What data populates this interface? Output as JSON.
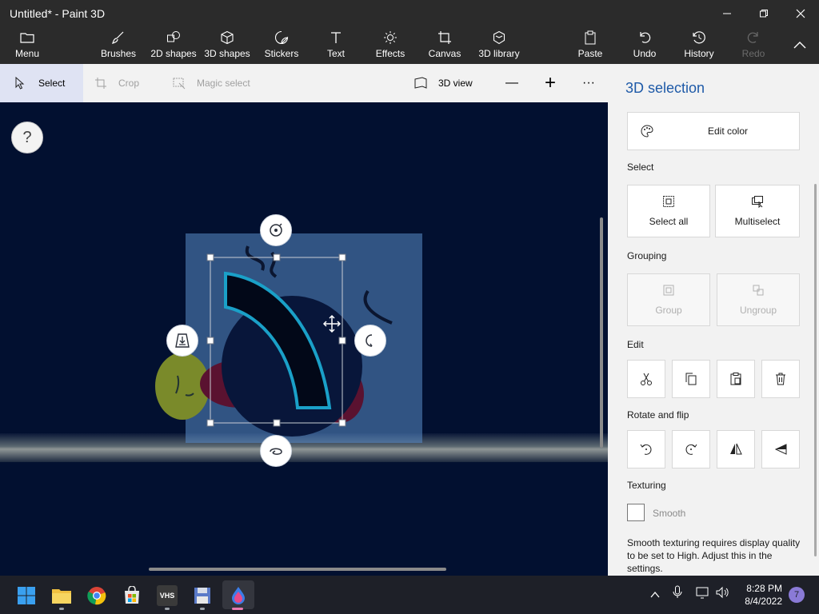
{
  "window": {
    "title": "Untitled* - Paint 3D",
    "controls": [
      "minimize-icon",
      "restore-icon",
      "close-icon"
    ]
  },
  "ribbon": {
    "menu": "Menu",
    "items": [
      "Brushes",
      "2D shapes",
      "3D shapes",
      "Stickers",
      "Text",
      "Effects",
      "Canvas",
      "3D library"
    ],
    "paste": "Paste",
    "undo": "Undo",
    "history": "History",
    "redo": "Redo"
  },
  "toolbar": {
    "select": "Select",
    "crop": "Crop",
    "magic_select": "Magic select",
    "view_3d": "3D view",
    "zoom_out": "—",
    "zoom_in": "+",
    "more": "···"
  },
  "canvas": {
    "help": "?"
  },
  "panel": {
    "title": "3D selection",
    "edit_color": "Edit color",
    "select_label": "Select",
    "select_all": "Select all",
    "multiselect": "Multiselect",
    "grouping_label": "Grouping",
    "group": "Group",
    "ungroup": "Ungroup",
    "edit_label": "Edit",
    "edit_buttons": [
      "cut-icon",
      "copy-icon",
      "paste-icon",
      "delete-icon"
    ],
    "rotate_label": "Rotate and flip",
    "rotate_buttons": [
      "rotate-left-icon",
      "rotate-right-icon",
      "flip-horizontal-icon",
      "flip-vertical-icon"
    ],
    "texturing_label": "Texturing",
    "smooth": "Smooth",
    "smooth_checked": false,
    "note": "Smooth texturing requires display quality to be set to High. Adjust this in the settings."
  },
  "taskbar": {
    "apps": [
      "windows-start-icon",
      "file-explorer-icon",
      "chrome-icon",
      "store-icon",
      "vhs-icon",
      "floppy-icon",
      "paint3d-icon"
    ],
    "vhs_label": "VHS",
    "time": "8:28 PM",
    "date": "8/4/2022",
    "notifications": "7"
  },
  "colors": {
    "canvas_bg": "#021030",
    "selection_fill": "#5a8cc8",
    "accent": "#1e5aa8",
    "highlight_stroke": "#1aa0c8"
  }
}
